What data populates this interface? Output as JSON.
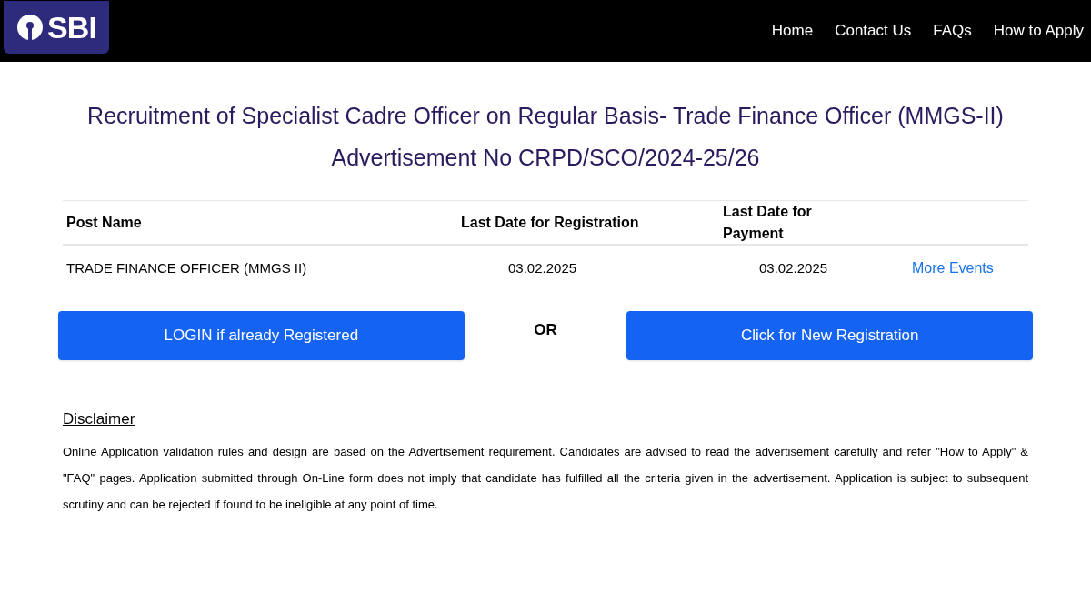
{
  "header": {
    "logo": "SBI",
    "nav": [
      "Home",
      "Contact Us",
      "FAQs",
      "How to Apply"
    ]
  },
  "title": [
    "Recruitment of Specialist Cadre Officer on Regular Basis- Trade Finance Officer (MMGS-II)",
    "Advertisement No CRPD/SCO/2024-25/26"
  ],
  "table": {
    "columns": [
      "Post Name",
      "Last Date for Registration",
      "Last Date for Payment"
    ],
    "rows": [
      {
        "post_name": "TRADE FINANCE OFFICER (MMGS II)",
        "registration": "03.02.2025",
        "payment": "03.02.2025",
        "link": "More Events"
      }
    ]
  },
  "actions": {
    "login": "LOGIN if already Registered",
    "or": "OR",
    "register": "Click for New Registration"
  },
  "disclaimer": {
    "heading": "Disclaimer",
    "text": "Online Application validation rules and design are based on the Advertisement requirement. Candidates are advised to read the advertisement carefully and refer \"How to Apply\" & \"FAQ\" pages. Application submitted through On-Line form does not imply that candidate has fulfilled all the criteria given in the advertisement. Application is subject to subsequent scrutiny and can be rejected if found to be ineligible at any point of time."
  }
}
